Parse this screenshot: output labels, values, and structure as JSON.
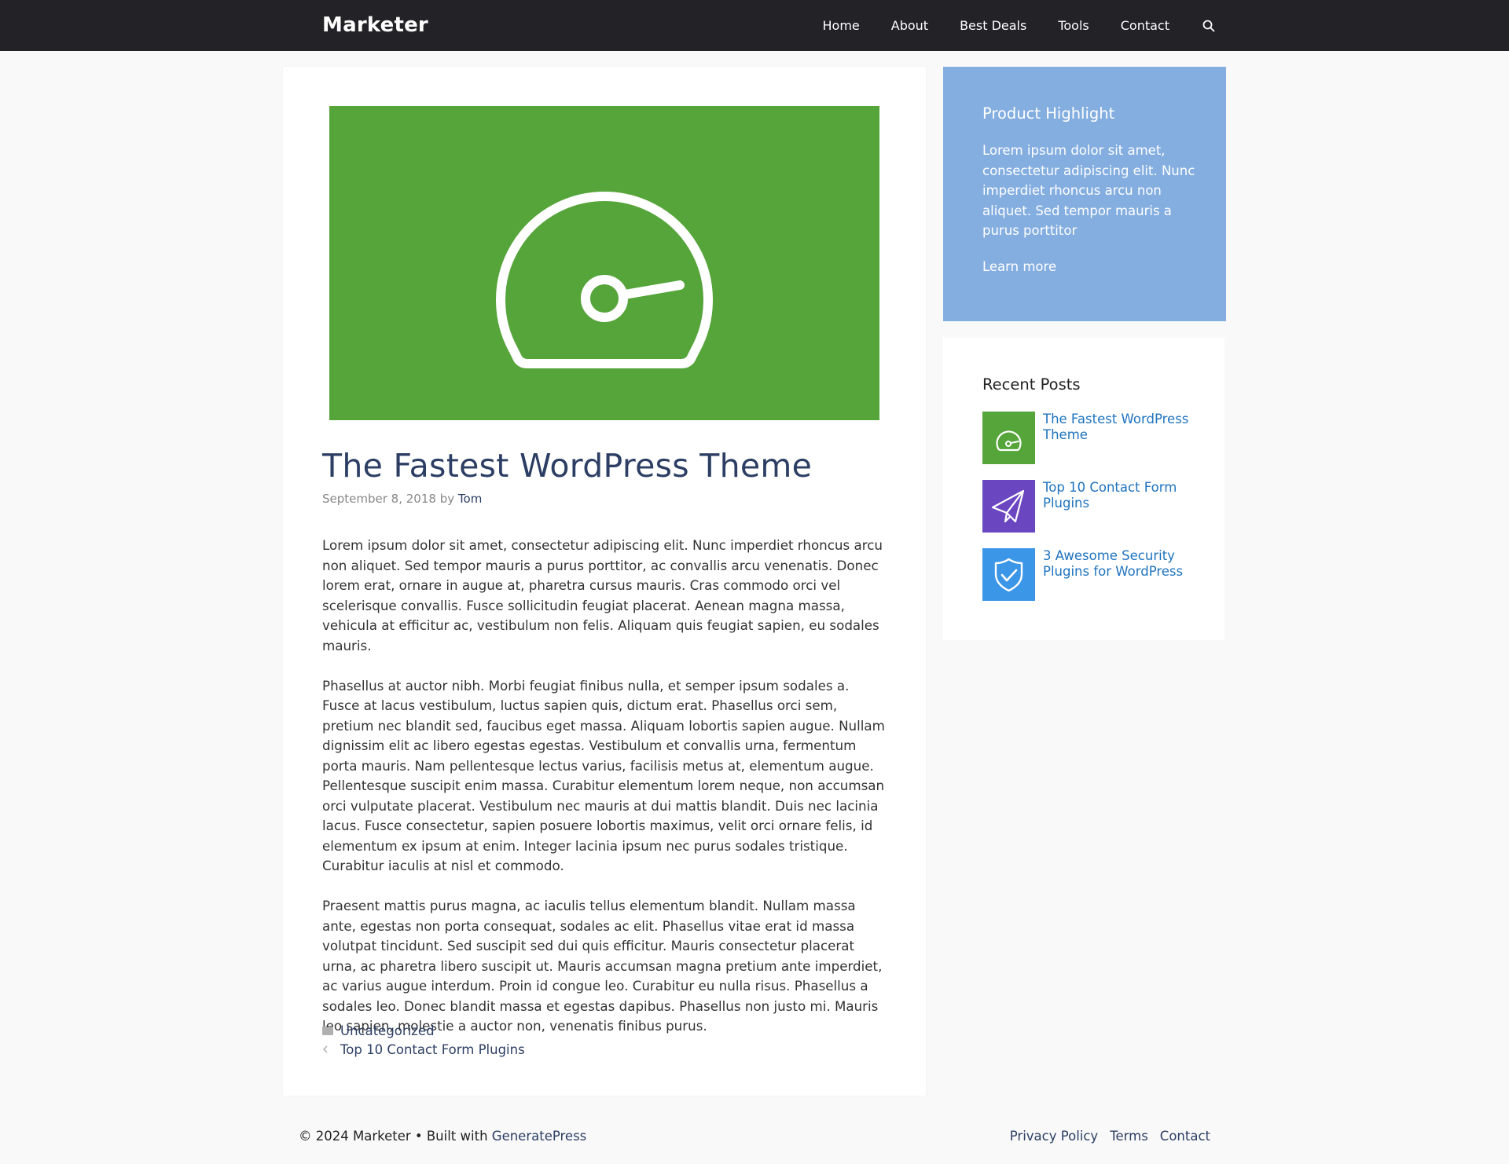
{
  "site": {
    "brand": "Marketer"
  },
  "nav": {
    "items": [
      "Home",
      "About",
      "Best Deals",
      "Tools",
      "Contact"
    ],
    "search_icon": "search-icon"
  },
  "article": {
    "title": "The Fastest WordPress Theme",
    "date": "September 8, 2018",
    "by": "by",
    "author": "Tom",
    "hero_color": "#55a53a",
    "hero_icon": "speedometer-icon",
    "paragraphs": [
      "Lorem ipsum dolor sit amet, consectetur adipiscing elit. Nunc imperdiet rhoncus arcu non aliquet. Sed tempor mauris a purus porttitor, ac convallis arcu venenatis. Donec lorem erat, ornare in augue at, pharetra cursus mauris. Cras commodo orci vel scelerisque convallis. Fusce sollicitudin feugiat placerat. Aenean magna massa, vehicula at efficitur ac, vestibulum non felis. Aliquam quis feugiat sapien, eu sodales mauris.",
      "Phasellus at auctor nibh. Morbi feugiat finibus nulla, et semper ipsum sodales a. Fusce at lacus vestibulum, luctus sapien quis, dictum erat. Phasellus orci sem, pretium nec blandit sed, faucibus eget massa. Aliquam lobortis sapien augue. Nullam dignissim elit ac libero egestas egestas. Vestibulum et convallis urna, fermentum porta mauris. Nam pellentesque lectus varius, facilisis metus at, elementum augue. Pellentesque suscipit enim massa. Curabitur elementum lorem neque, non accumsan orci vulputate placerat. Vestibulum nec mauris at dui mattis blandit. Duis nec lacinia lacus. Fusce consectetur, sapien posuere lobortis maximus, velit orci ornare felis, id elementum ex ipsum at enim. Integer lacinia ipsum nec purus sodales tristique. Curabitur iaculis at nisl et commodo.",
      "Praesent mattis purus magna, ac iaculis tellus elementum blandit. Nullam massa ante, egestas non porta consequat, sodales ac elit. Phasellus vitae erat id massa volutpat tincidunt. Sed suscipit sed dui quis efficitur. Mauris consectetur placerat urna, ac pharetra libero suscipit ut. Mauris accumsan magna pretium ante imperdiet, ac varius augue interdum. Proin id congue leo. Curabitur eu nulla risus. Phasellus a sodales leo. Donec blandit massa et egestas dapibus. Phasellus non justo mi. Mauris leo sapien, molestie a auctor non, venenatis finibus purus."
    ],
    "category": "Uncategorized",
    "prev_post": "Top 10 Contact Form Plugins"
  },
  "sidebar": {
    "highlight": {
      "title": "Product Highlight",
      "text": "Lorem ipsum dolor sit amet, consectetur adipiscing elit. Nunc imperdiet rhoncus arcu non aliquet. Sed tempor mauris a purus porttitor",
      "link": "Learn more",
      "bg_color": "#84aee0"
    },
    "recent": {
      "title": "Recent Posts",
      "posts": [
        {
          "title": "The Fastest WordPress Theme",
          "color": "#55a53a",
          "icon": "speedometer-icon"
        },
        {
          "title": "Top 10 Contact Form Plugins",
          "color": "#6b46c1",
          "icon": "paper-plane-icon"
        },
        {
          "title": "3 Awesome Security Plugins for WordPress",
          "color": "#3b96e8",
          "icon": "shield-check-icon"
        }
      ]
    }
  },
  "footer": {
    "copyright": "© 2024 Marketer • Built with",
    "built_with": "GeneratePress",
    "links": [
      "Privacy Policy",
      "Terms",
      "Contact"
    ]
  }
}
